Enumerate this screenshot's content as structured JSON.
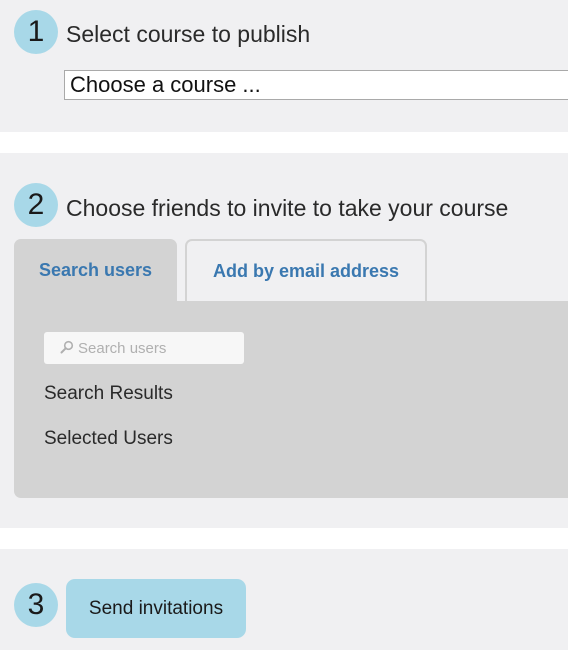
{
  "step1": {
    "number": "1",
    "title": "Select course to publish",
    "course_select_value": "Choose a course ..."
  },
  "step2": {
    "number": "2",
    "title": "Choose friends to invite to take your course",
    "tabs": [
      {
        "label": "Search users",
        "active": true
      },
      {
        "label": "Add by email address",
        "active": false
      }
    ],
    "search": {
      "placeholder": "Search users",
      "icon": "search-icon"
    },
    "search_results_label": "Search Results",
    "selected_users_label": "Selected Users"
  },
  "step3": {
    "number": "3",
    "send_button_label": "Send invitations"
  },
  "colors": {
    "accent": "#a8d8e8",
    "section_bg": "#f0f0f2",
    "panel_bg": "#d3d3d3",
    "tab_text": "#3a78b0"
  }
}
